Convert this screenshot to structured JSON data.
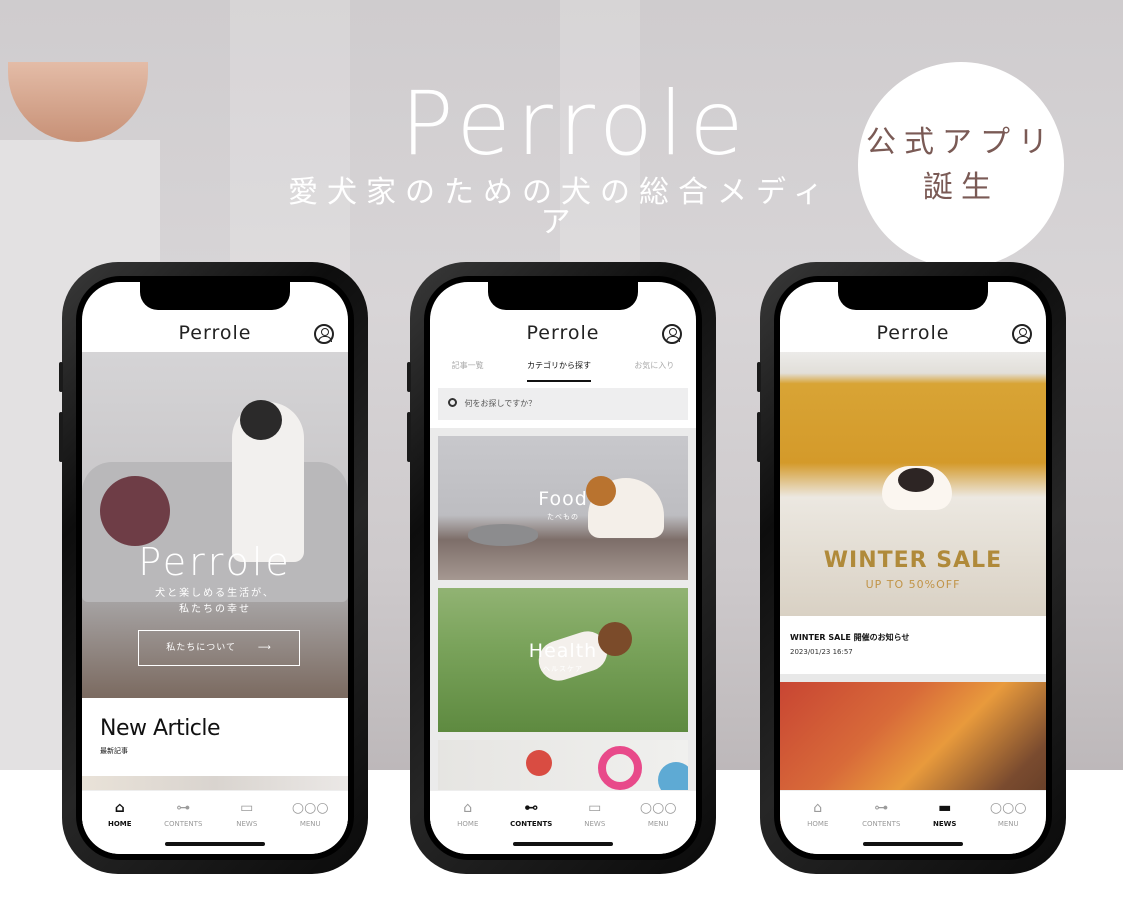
{
  "hero": {
    "brand": "Perrole",
    "tagline": "愛犬家のための犬の総合メディア",
    "badge_line1": "公式アプリ",
    "badge_line2": "誕生"
  },
  "tabbar": {
    "items": [
      {
        "label": "HOME",
        "icon": "home-icon"
      },
      {
        "label": "CONTENTS",
        "icon": "bone-icon"
      },
      {
        "label": "NEWS",
        "icon": "chat-icon"
      },
      {
        "label": "MENU",
        "icon": "more-dots-icon"
      }
    ]
  },
  "phone1": {
    "header_title": "Perrole",
    "hero_brand": "Perrole",
    "hero_line1": "犬と楽しめる生活が、",
    "hero_line2": "私たちの幸せ",
    "about_button": "私たちについて",
    "about_arrow": "⟶",
    "new_article_title": "New Article",
    "new_article_sub": "最新記事",
    "active_tab": "HOME"
  },
  "phone2": {
    "header_title": "Perrole",
    "tabs": [
      "記事一覧",
      "カテゴリから探す",
      "お気に入り"
    ],
    "active_tab_index": 1,
    "search_placeholder": "何をお探しですか？",
    "categories": [
      {
        "title": "Food",
        "sub": "たべもの"
      },
      {
        "title": "Health",
        "sub": "ヘルスケア"
      }
    ],
    "active_tab": "CONTENTS"
  },
  "phone3": {
    "header_title": "Perrole",
    "sale_title": "WINTER SALE",
    "sale_sub": "UP TO 50%OFF",
    "news_title": "WINTER SALE 開催のお知らせ",
    "news_date": "2023/01/23 16:57",
    "active_tab": "NEWS"
  },
  "colors": {
    "badge_text": "#7a5a55",
    "sale_gold": "#b08a3a",
    "tab_active": "#111111",
    "tab_inactive": "#9b9b9b"
  }
}
